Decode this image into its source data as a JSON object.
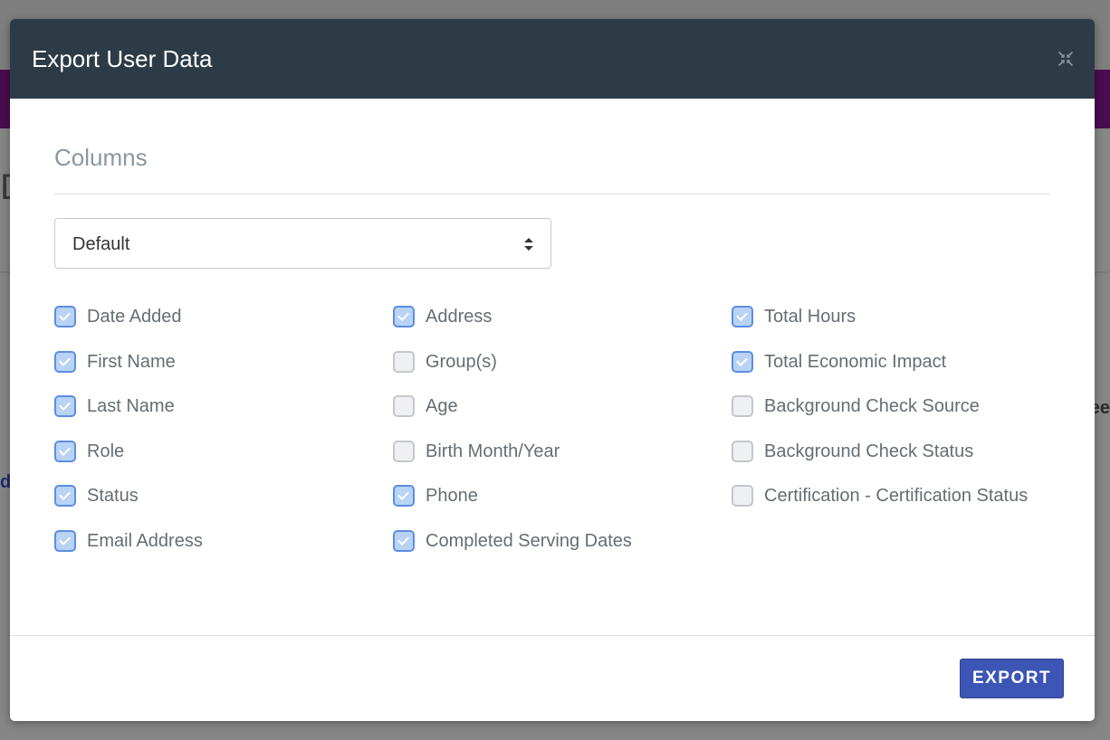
{
  "background": {
    "fragment_left": "Da",
    "fragment_left2": "d.l",
    "fragment_right": "ee"
  },
  "modal": {
    "title": "Export User Data",
    "close_icon": "close-icon",
    "section_title": "Columns",
    "preset_select": {
      "value": "Default"
    },
    "columns": [
      [
        {
          "label": "Date Added",
          "checked": true
        },
        {
          "label": "First Name",
          "checked": true
        },
        {
          "label": "Last Name",
          "checked": true
        },
        {
          "label": "Role",
          "checked": true
        },
        {
          "label": "Status",
          "checked": true
        },
        {
          "label": "Email Address",
          "checked": true
        }
      ],
      [
        {
          "label": "Address",
          "checked": true
        },
        {
          "label": "Group(s)",
          "checked": false
        },
        {
          "label": "Age",
          "checked": false
        },
        {
          "label": "Birth Month/Year",
          "checked": false
        },
        {
          "label": "Phone",
          "checked": true
        },
        {
          "label": "Completed Serving Dates",
          "checked": true
        }
      ],
      [
        {
          "label": "Total Hours",
          "checked": true
        },
        {
          "label": "Total Economic Impact",
          "checked": true
        },
        {
          "label": "Background Check Source",
          "checked": false
        },
        {
          "label": "Background Check Status",
          "checked": false
        },
        {
          "label": "Certification - Certification Status",
          "checked": false
        }
      ]
    ],
    "export_label": "EXPORT"
  },
  "colors": {
    "header_bg": "#2c3b46",
    "accent": "#3d55b5",
    "checkbox_checked": "#5b8ee4",
    "purple_bar": "#4a0d4f"
  }
}
